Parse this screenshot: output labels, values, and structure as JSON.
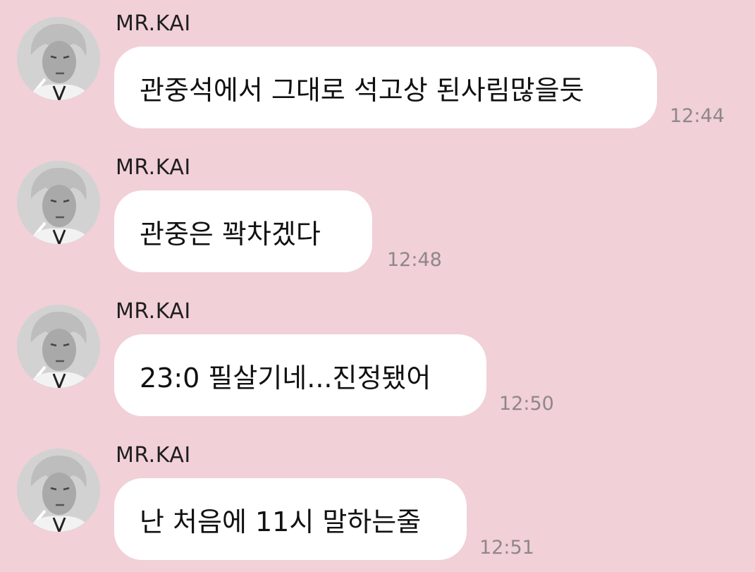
{
  "chat": {
    "messages": [
      {
        "sender": "MR.KAI",
        "text": "관중석에서 그대로 석고상 된사림많을듯",
        "time": "12:44"
      },
      {
        "sender": "MR.KAI",
        "text": "관중은 꽉차겠다",
        "time": "12:48"
      },
      {
        "sender": "MR.KAI",
        "text": "23:0 필살기네...진정됐어",
        "time": "12:50"
      },
      {
        "sender": "MR.KAI",
        "text": "난 처음에 11시 말하는줄",
        "time": "12:51"
      }
    ]
  },
  "colors": {
    "background": "#f1d0d7",
    "bubble": "#ffffff",
    "text": "#111111",
    "timestamp": "#8f8789"
  },
  "icons": {
    "avatar": "profile-photo-avatar-icon"
  }
}
